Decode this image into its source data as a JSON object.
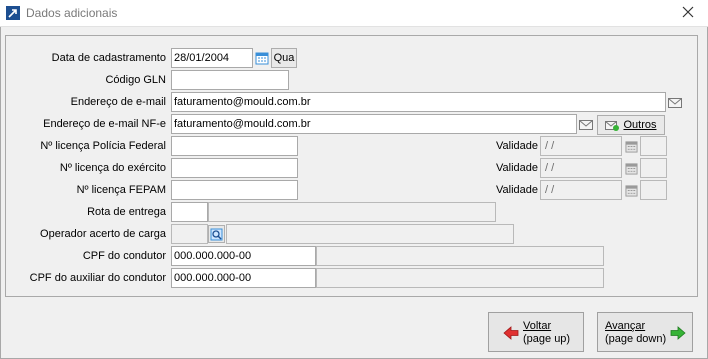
{
  "window": {
    "title": "Dados adicionais",
    "app_icon": "app-arrow-icon",
    "close_icon": "close-icon"
  },
  "form": {
    "data_cadastramento": {
      "label": "Data de cadastramento",
      "value": "28/01/2004",
      "weekday": "Qua"
    },
    "codigo_gln": {
      "label": "Código GLN",
      "value": ""
    },
    "email": {
      "label": "Endereço de e-mail",
      "value": "faturamento@mould.com.br"
    },
    "email_nfe": {
      "label": "Endereço de e-mail NF-e",
      "value": "faturamento@mould.com.br",
      "outros_label": "Outros"
    },
    "licenca_pf": {
      "label": "Nº licença Polícia Federal",
      "value": "",
      "validade_label": "Validade",
      "validade_value": "/ /"
    },
    "licenca_exercito": {
      "label": "Nº licença do exército",
      "value": "",
      "validade_label": "Validade",
      "validade_value": "/ /"
    },
    "licenca_fepam": {
      "label": "Nº licença FEPAM",
      "value": "",
      "validade_label": "Validade",
      "validade_value": "/ /"
    },
    "rota_entrega": {
      "label": "Rota de entrega",
      "code": "",
      "description": ""
    },
    "operador_carga": {
      "label": "Operador acerto de carga",
      "code": "",
      "description": ""
    },
    "cpf_condutor": {
      "label": "CPF do condutor",
      "value": "000.000.000-00",
      "name": ""
    },
    "cpf_auxiliar": {
      "label": "CPF do auxiliar do condutor",
      "value": "000.000.000-00",
      "name": ""
    }
  },
  "footer": {
    "voltar": {
      "line1": "Voltar",
      "line2": "(page up)"
    },
    "avancar": {
      "line1": "Avançar",
      "line2": "(page down)"
    }
  },
  "colors": {
    "back_arrow": "#e03030",
    "forward_arrow": "#36b336",
    "calendar": "#3a8fd8"
  }
}
